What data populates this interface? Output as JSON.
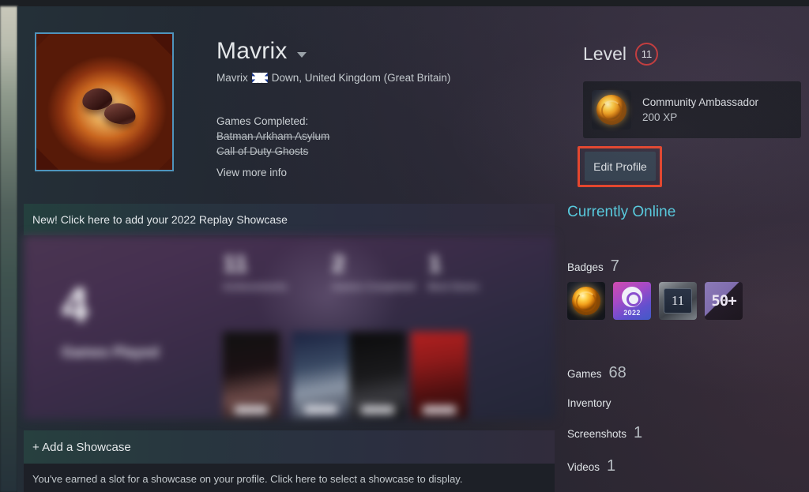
{
  "profile": {
    "persona_name": "Mavrix",
    "real_name": "Mavrix",
    "country_flag_icon": "united-kingdom-flag-icon",
    "location": "Down, United Kingdom (Great Britain)",
    "summary_heading": "Games Completed:",
    "completed_games": [
      "Batman Arkham Asylum",
      "Call of Duty Ghosts"
    ],
    "view_more_label": "View more info",
    "avatar_alt": "coffee-beans-avatar"
  },
  "level": {
    "label": "Level",
    "value": "11",
    "circle_color": "#c73a3a"
  },
  "favorite_badge": {
    "icon": "gold-community-medal-icon",
    "title": "Community Ambassador",
    "xp": "200 XP"
  },
  "edit_profile": {
    "label": "Edit Profile",
    "highlight_color": "#e8442a"
  },
  "replay_showcase": {
    "banner_label": "New! Click here to add your 2022 Replay Showcase",
    "big_number": "4",
    "big_label": "Games Played",
    "stats": [
      {
        "value": "11",
        "label": "Achievements"
      },
      {
        "value": "2",
        "label": "Games Completed"
      },
      {
        "value": "1",
        "label": "Best Genre"
      }
    ],
    "cards": [
      "game-cover-1",
      "game-cover-2",
      "game-cover-3",
      "game-cover-4"
    ]
  },
  "add_showcase": {
    "label": "+ Add a Showcase",
    "description": "You've earned a slot for a showcase on your profile. Click here to select a showcase to display."
  },
  "sidebar": {
    "online_status": "Currently Online",
    "online_color": "#57cbde",
    "badges": {
      "label": "Badges",
      "count": "7",
      "items": [
        {
          "icon": "gold-community-medal-icon",
          "name": "Community Ambassador"
        },
        {
          "icon": "steam-2022-replay-badge-icon",
          "name": "2022",
          "year": "2022"
        },
        {
          "icon": "steam-level-11-badge-icon",
          "name": "11"
        },
        {
          "icon": "fifty-plus-games-badge-icon",
          "name": "50+"
        }
      ]
    },
    "stats": [
      {
        "label": "Games",
        "value": "68"
      },
      {
        "label": "Inventory",
        "value": ""
      },
      {
        "label": "Screenshots",
        "value": "1"
      },
      {
        "label": "Videos",
        "value": "1"
      }
    ]
  }
}
